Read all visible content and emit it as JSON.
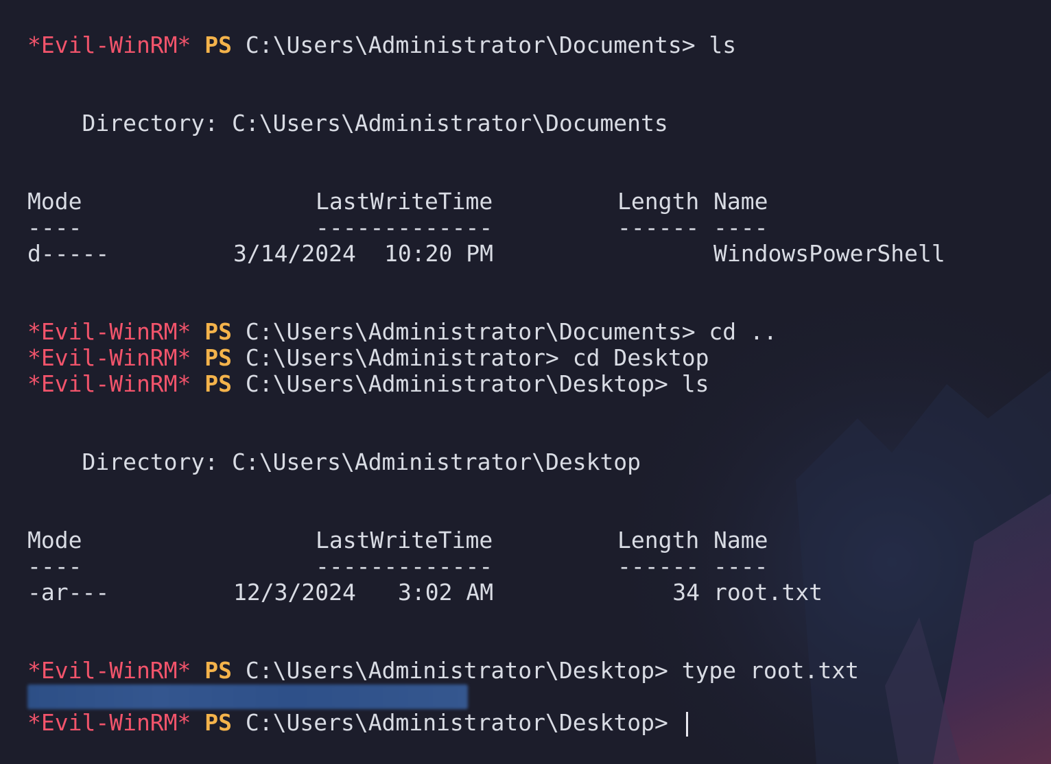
{
  "colors": {
    "background": "#1c1d2b",
    "prompt_evil": "#f2546b",
    "prompt_ps": "#f4b34b",
    "text": "#d9dce4",
    "redaction": "#2f5189"
  },
  "prompt": {
    "evil": "*Evil-WinRM*",
    "ps": "PS"
  },
  "commands": [
    {
      "path": "C:\\Users\\Administrator\\Documents>",
      "cmd": " ls"
    },
    {
      "path": "C:\\Users\\Administrator\\Documents>",
      "cmd": " cd .."
    },
    {
      "path": "C:\\Users\\Administrator>",
      "cmd": " cd Desktop"
    },
    {
      "path": "C:\\Users\\Administrator\\Desktop>",
      "cmd": " ls"
    },
    {
      "path": "C:\\Users\\Administrator\\Desktop>",
      "cmd": " type root.txt"
    },
    {
      "path": "C:\\Users\\Administrator\\Desktop>",
      "cmd": " "
    }
  ],
  "listings": [
    {
      "directory": "    Directory: C:\\Users\\Administrator\\Documents",
      "headers": {
        "mode": "Mode",
        "time": "LastWriteTime",
        "length": "Length",
        "name": "Name"
      },
      "dashes": {
        "mode": "----",
        "time": "-------------",
        "length": "------",
        "name": "----"
      },
      "row": {
        "mode": "d-----",
        "date": "3/14/2024",
        "time": "10:20 PM",
        "length": "",
        "name": "WindowsPowerShell"
      }
    },
    {
      "directory": "    Directory: C:\\Users\\Administrator\\Desktop",
      "headers": {
        "mode": "Mode",
        "time": "LastWriteTime",
        "length": "Length",
        "name": "Name"
      },
      "dashes": {
        "mode": "----",
        "time": "-------------",
        "length": "------",
        "name": "----"
      },
      "row": {
        "mode": "-ar---",
        "date": "12/3/2024",
        "time": "3:02 AM",
        "length": "34",
        "name": "root.txt"
      }
    }
  ],
  "output": {
    "flag_redacted": true
  }
}
